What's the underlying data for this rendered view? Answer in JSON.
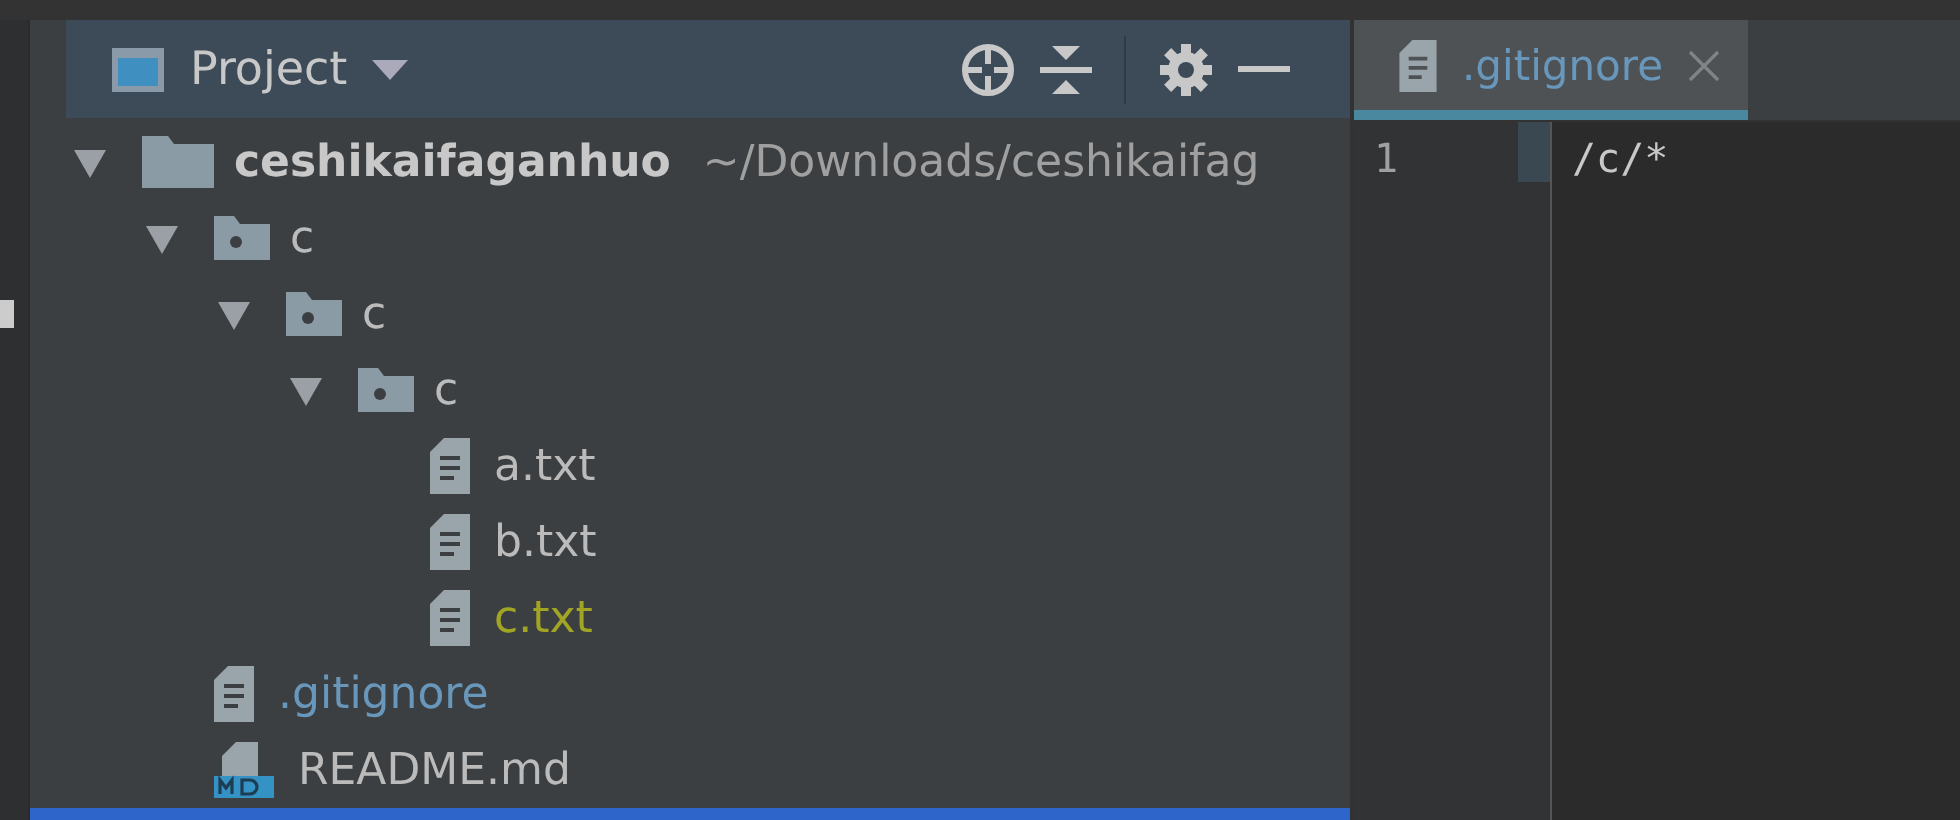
{
  "project_panel": {
    "title": "Project",
    "toolbar": [
      {
        "kind": "locate"
      },
      {
        "kind": "collapse"
      },
      {
        "kind": "settings"
      },
      {
        "kind": "hide"
      }
    ]
  },
  "tree": [
    {
      "name": "ceshikaifaganhuo",
      "path": "~/Downloads/ceshikaifag",
      "kind": "root",
      "expanded": true,
      "children": [
        {
          "name": "c",
          "kind": "folder",
          "expanded": true,
          "children": [
            {
              "name": "c",
              "kind": "folder",
              "expanded": true,
              "children": [
                {
                  "name": "c",
                  "kind": "folder",
                  "expanded": true,
                  "children": [
                    {
                      "name": "a.txt",
                      "kind": "file",
                      "color": "#bbbbbb"
                    },
                    {
                      "name": "b.txt",
                      "kind": "file",
                      "color": "#bbbbbb"
                    },
                    {
                      "name": "c.txt",
                      "kind": "file",
                      "color": "#a2a523"
                    }
                  ]
                }
              ]
            }
          ]
        },
        {
          "name": ".gitignore",
          "kind": "file",
          "color": "#6897bb"
        },
        {
          "name": "README.md",
          "kind": "markdown",
          "color": "#bbbbbb"
        }
      ]
    }
  ],
  "editor": {
    "tabs": [
      {
        "label": ".gitignore",
        "selected": true
      }
    ],
    "lines": [
      {
        "number": "1",
        "text": "/c/*"
      }
    ]
  }
}
